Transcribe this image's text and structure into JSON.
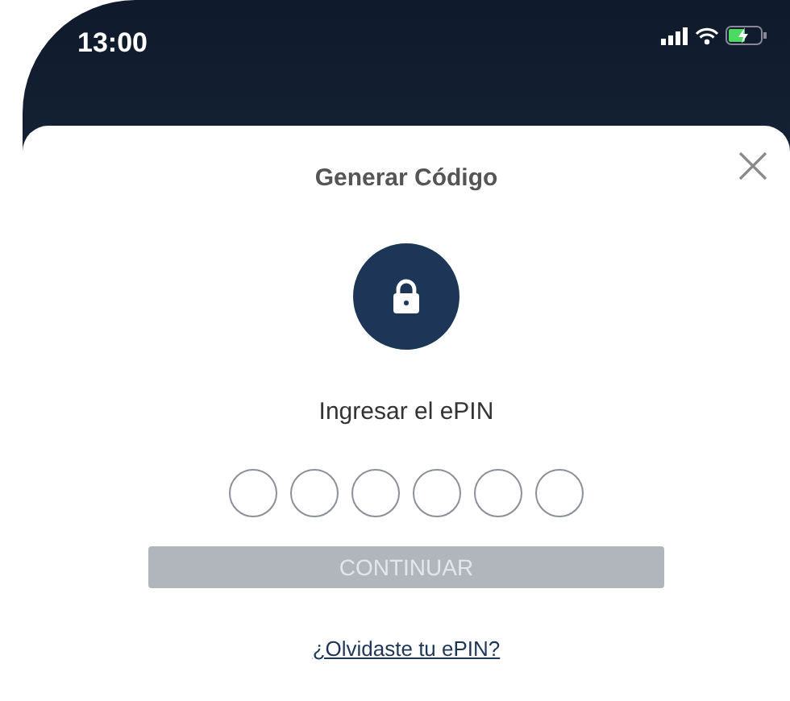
{
  "status_bar": {
    "time": "13:00"
  },
  "sheet": {
    "title": "Generar Código",
    "prompt": "Ingresar el ePIN",
    "pin_digits": [
      {
        "filled": false
      },
      {
        "filled": false
      },
      {
        "filled": false
      },
      {
        "filled": false
      },
      {
        "filled": false
      },
      {
        "filled": false
      }
    ],
    "button": {
      "label": "CONTINUAR",
      "disabled": true
    },
    "link": "¿Olvidaste tu ePIN?"
  }
}
